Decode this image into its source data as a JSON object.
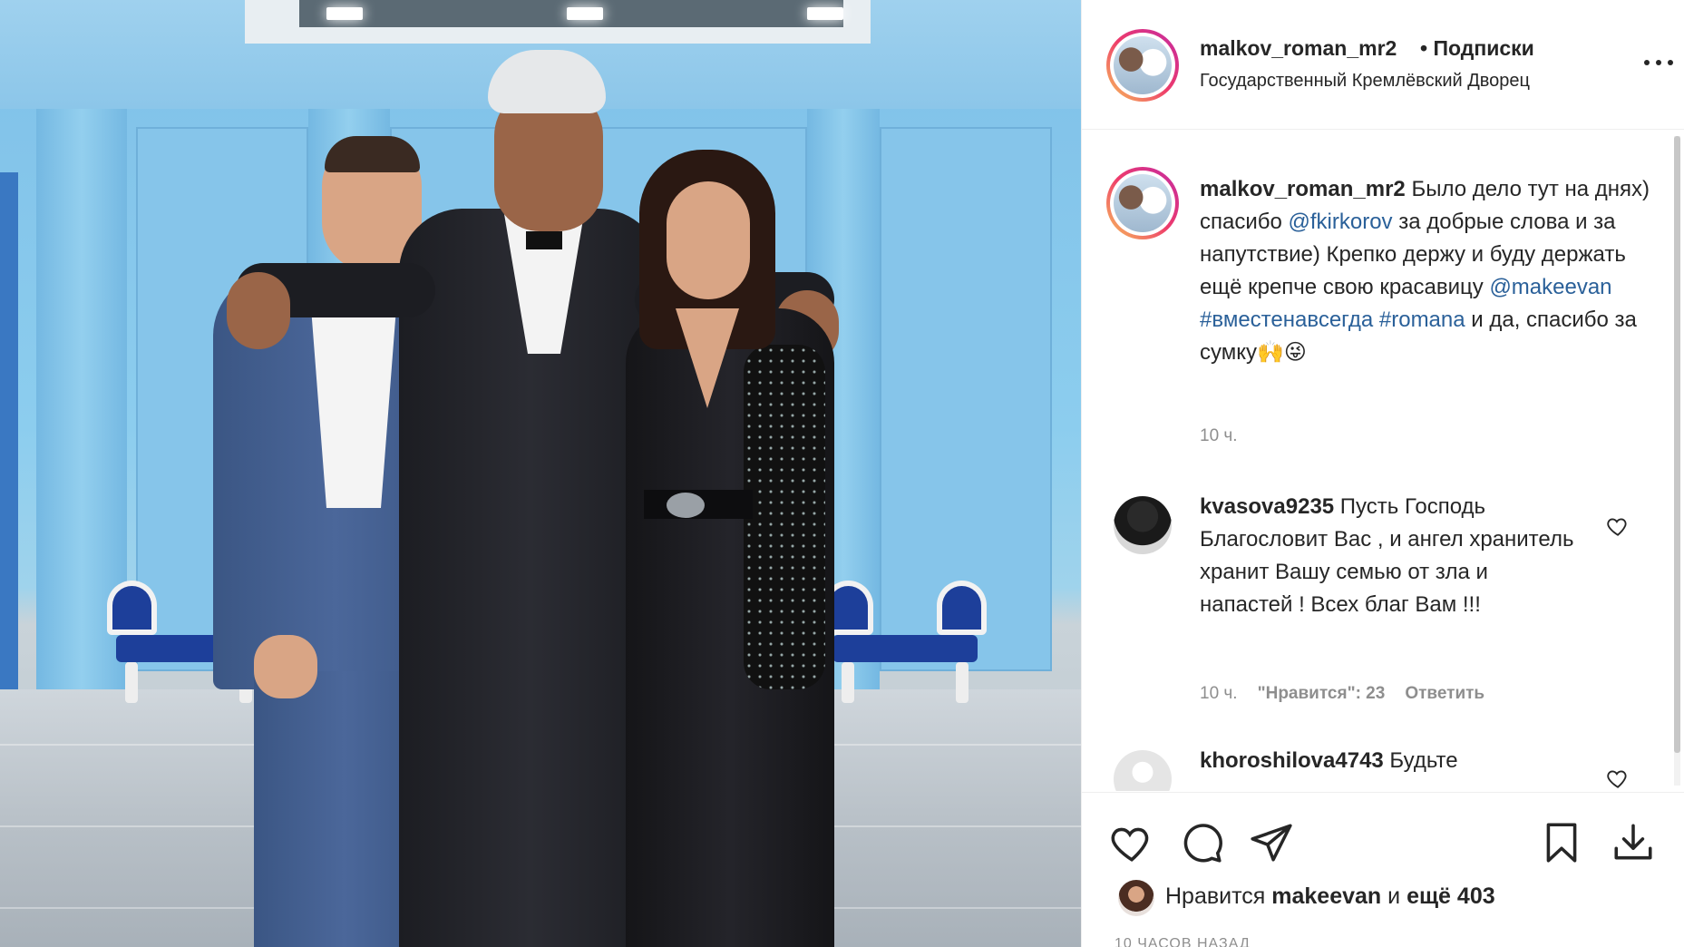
{
  "post": {
    "username": "malkov_roman_mr2",
    "follow_label": "• Подписки",
    "location": "Государственный Кремлёвский Дворец",
    "more_icon": "more-horizontal-icon"
  },
  "caption": {
    "username": "malkov_roman_mr2",
    "text_1": " Было дело тут на днях) спасибо ",
    "mention_1": "@fkirkorov",
    "text_2": " за добрые слова и за напутствие) Крепко держу и буду держать ещё крепче свою красавицу ",
    "mention_2": "@makeevan",
    "hashtag_1": "#вместенавсегда",
    "hashtag_2": "#romana",
    "text_3": " и да, спасибо за сумку",
    "emojis": "🙌😜",
    "time": "10 ч."
  },
  "comments": [
    {
      "username": "kvasova9235",
      "text": " Пусть Господь Благословит Вас , и ангел хранитель хранит Вашу семью от зла и напастей ! Всех благ Вам !!!",
      "time": "10 ч.",
      "likes": "\"Нравится\": 23",
      "reply": "Ответить"
    },
    {
      "username": "khoroshilova4743",
      "text": " Будьте"
    }
  ],
  "actions": {
    "like_icon": "heart-icon",
    "comment_icon": "comment-icon",
    "share_icon": "paper-plane-icon",
    "save_icon": "bookmark-icon",
    "download_icon": "download-icon"
  },
  "likes": {
    "prefix": "Нравится ",
    "user": "makeevan",
    "middle": " и ",
    "count": "ещё 403"
  },
  "posted_ago": "10 ЧАСОВ НАЗАД"
}
